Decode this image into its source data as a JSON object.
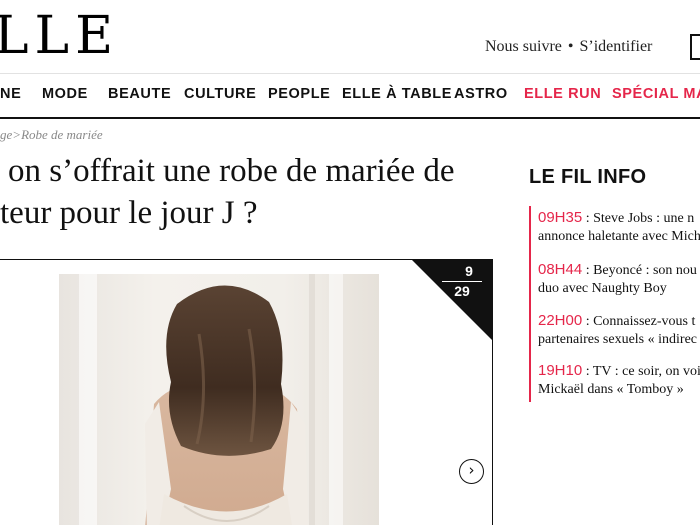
{
  "header": {
    "logo": "LLE",
    "follow": "Nous suivre",
    "separator": "•",
    "login": "S’identifier"
  },
  "nav": {
    "items": [
      "NE",
      "MODE",
      "BEAUTE",
      "CULTURE",
      "PEOPLE",
      "ELLE À TABLE",
      "ASTRO",
      "ELLE RUN",
      "SPÉCIAL MA"
    ],
    "accent_color": "#e5264a"
  },
  "breadcrumb": {
    "prefix": "ge",
    "sep": ">",
    "current": "Robe de mariée"
  },
  "article": {
    "title_line1": "on s’offrait une robe de mariée de",
    "title_line2": "teur pour le jour J ?"
  },
  "slideshow": {
    "current": "9",
    "total": "29",
    "next_icon": "chevron-right-icon"
  },
  "fil_info": {
    "title": "LE FIL INFO",
    "items": [
      {
        "time": "09H35",
        "line1": " : Steve Jobs : une n",
        "line2": "annonce haletante avec Mich"
      },
      {
        "time": "08H44",
        "line1": " : Beyoncé : son nou",
        "line2": "duo avec Naughty Boy"
      },
      {
        "time": "22H00",
        "line1": " : Connaissez-vous t",
        "line2": "partenaires sexuels « indirec"
      },
      {
        "time": "19H10",
        "line1": " : TV : ce soir, on voit",
        "line2": "Mickaël dans « Tomboy »"
      }
    ]
  }
}
